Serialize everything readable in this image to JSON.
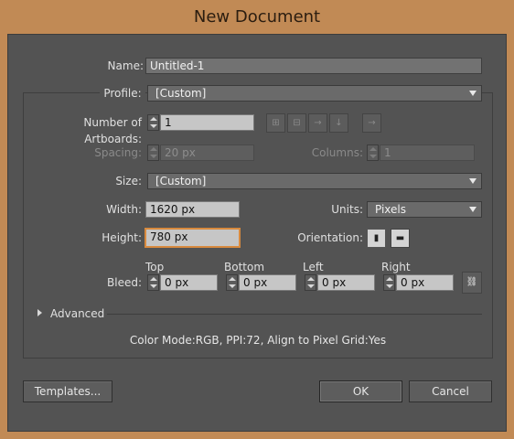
{
  "window": {
    "title": "New Document"
  },
  "name": {
    "label": "Name:",
    "value": "Untitled-1"
  },
  "profile": {
    "label": "Profile:",
    "value": "[Custom]"
  },
  "artboards": {
    "label": "Number of Artboards:",
    "value": "1"
  },
  "spacing": {
    "label": "Spacing:",
    "value": "20 px"
  },
  "columns": {
    "label": "Columns:",
    "value": "1"
  },
  "size": {
    "label": "Size:",
    "value": "[Custom]"
  },
  "width": {
    "label": "Width:",
    "value": "1620 px"
  },
  "units": {
    "label": "Units:",
    "value": "Pixels"
  },
  "height": {
    "label": "Height:",
    "value": "780 px"
  },
  "orientation": {
    "label": "Orientation:"
  },
  "bleed": {
    "label": "Bleed:",
    "top": {
      "label": "Top",
      "value": "0 px"
    },
    "bottom": {
      "label": "Bottom",
      "value": "0 px"
    },
    "left": {
      "label": "Left",
      "value": "0 px"
    },
    "right": {
      "label": "Right",
      "value": "0 px"
    }
  },
  "advanced": {
    "label": "Advanced"
  },
  "info": "Color Mode:RGB, PPI:72, Align to Pixel Grid:Yes",
  "buttons": {
    "templates": "Templates...",
    "ok": "OK",
    "cancel": "Cancel"
  },
  "colors": {
    "titlebar": "#c18a55",
    "dialog": "#535353",
    "focus": "#d88a3e"
  }
}
